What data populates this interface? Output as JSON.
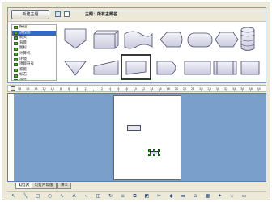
{
  "toolbar": {
    "new_theme_label": "新建主题",
    "gallery_title": "主题：所有主题名"
  },
  "theme_list": {
    "items": [
      {
        "label": "按钮"
      },
      {
        "label": "流程图"
      },
      {
        "label": "箭头"
      },
      {
        "label": "背景"
      },
      {
        "label": "图标"
      },
      {
        "label": "计算机"
      },
      {
        "label": "环境"
      },
      {
        "label": "项目符号"
      },
      {
        "label": "家庭"
      },
      {
        "label": "标志"
      },
      {
        "label": "声音"
      }
    ],
    "selected_index": 1
  },
  "shapes": {
    "row1": [
      "manual-operation",
      "cube-process",
      "punched-tape",
      "display-shape",
      "terminator",
      "preparation",
      "magnetic-disk"
    ],
    "row2": [
      "merge-triangle",
      "manual-input",
      "parallelogram",
      "delay",
      "process-rect",
      "predefined-process",
      "card"
    ],
    "selected": "parallelogram"
  },
  "ruler": {
    "ticks": [
      "18",
      "16",
      "14",
      "12",
      "10",
      "8",
      "6",
      "4",
      "2",
      "",
      "2",
      "4",
      "6",
      "8",
      "10",
      "12",
      "14",
      "16",
      "18",
      "20",
      "22",
      "24",
      "26",
      "28",
      "30",
      "32",
      "34",
      "36",
      "38",
      "40"
    ]
  },
  "tabs": [
    {
      "label": "幻灯片"
    },
    {
      "label": "幻灯片母版"
    },
    {
      "label": "讲义"
    }
  ],
  "draw_toolbar": {
    "icons": [
      "select-arrow-icon",
      "line-icon",
      "rectangle-icon",
      "ellipse-icon",
      "curve-icon",
      "text-icon",
      "connector-icon",
      "3d-icon",
      "rotate-icon",
      "align-icon",
      "arrange-icon",
      "shadow-icon",
      "crop-icon",
      "fill-icon",
      "line-color-icon",
      "font-icon",
      "gallery-icon",
      "effects-icon",
      "star-icon",
      "callout-icon"
    ]
  },
  "colors": {
    "workspace": "#7a9fca",
    "selection_highlight": "#316ac5",
    "handle_green": "#1fa01f"
  }
}
